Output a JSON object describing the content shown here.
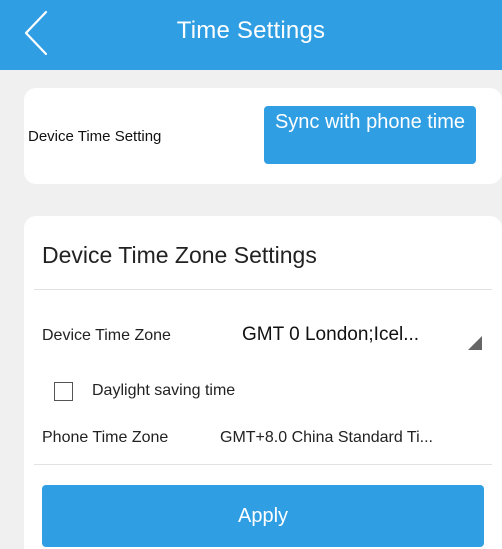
{
  "header": {
    "title": "Time Settings",
    "back_icon": "chevron-left-icon",
    "background_color": "#2f9ee3"
  },
  "device_time": {
    "label": "Device Time Setting",
    "sync_button_label": "Sync with phone time"
  },
  "time_zone": {
    "section_title": "Device Time Zone Settings",
    "device_tz_label": "Device Time Zone",
    "device_tz_value": "GMT 0 London;Icel...",
    "dst_label": "Daylight saving time",
    "dst_checked": false,
    "phone_tz_label": "Phone Time Zone",
    "phone_tz_value": "GMT+8.0  China Standard Ti...",
    "apply_label": "Apply"
  },
  "colors": {
    "accent": "#2f9ee3",
    "background": "#f0f0f0",
    "card": "#ffffff"
  }
}
